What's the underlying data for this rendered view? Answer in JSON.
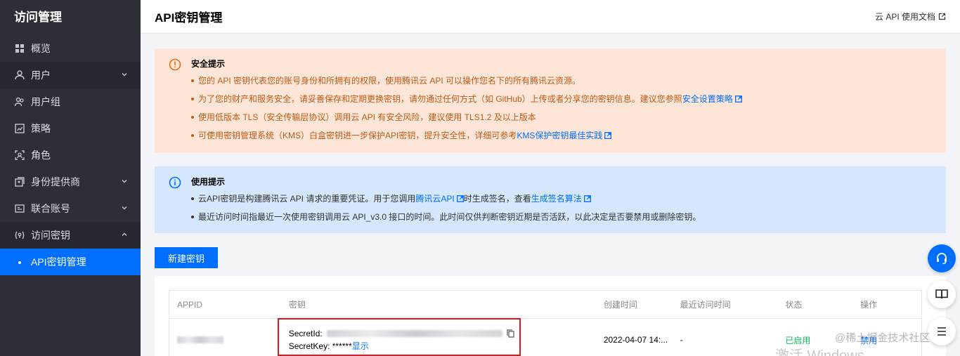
{
  "sidebar": {
    "brand": "访问管理",
    "items": [
      {
        "label": "概览",
        "icon": "grid-icon"
      },
      {
        "label": "用户",
        "icon": "user-icon"
      },
      {
        "label": "用户组",
        "icon": "user-group-icon"
      },
      {
        "label": "策略",
        "icon": "policy-icon"
      },
      {
        "label": "角色",
        "icon": "role-icon"
      },
      {
        "label": "身份提供商",
        "icon": "identity-provider-icon"
      },
      {
        "label": "联合账号",
        "icon": "federated-account-icon"
      },
      {
        "label": "访问密钥",
        "icon": "access-key-icon"
      },
      {
        "label": "API密钥管理"
      }
    ]
  },
  "header": {
    "title": "API密钥管理",
    "doc_link": "云 API 使用文档"
  },
  "security_alert": {
    "title": "安全提示",
    "items": [
      {
        "text": "您的 API 密钥代表您的账号身份和所拥有的权限，使用腾讯云 API 可以操作您名下的所有腾讯云资源。"
      },
      {
        "text": "为了您的财产和服务安全，请妥善保存和定期更换密钥，请勿通过任何方式（如 GitHub）上传或者分享您的密钥信息。建议您参照",
        "link": "安全设置策略"
      },
      {
        "text": "使用低版本 TLS（安全传输层协议）调用云 API 有安全风险，建议使用 TLS1.2 及以上版本"
      },
      {
        "text": "可使用密钥管理系统（KMS）白盒密钥进一步保护API密钥，提升安全性，详细可参考",
        "link": "KMS保护密钥最佳实践"
      }
    ]
  },
  "usage_alert": {
    "title": "使用提示",
    "item1_a": "云API密钥是构建腾讯云 API 请求的重要凭证。用于您调用",
    "item1_link1": "腾讯云API",
    "item1_b": "时生成签名，查看",
    "item1_link2": "生成签名算法",
    "item2": "最近访问时间指最近一次使用密钥调用云 API_v3.0 接口的时间。此时间仅供判断密钥近期是否活跃，以此决定是否要禁用或删除密钥。"
  },
  "new_key_button": "新建密钥",
  "table": {
    "columns": [
      "APPID",
      "密钥",
      "创建时间",
      "最近访问时间",
      "状态",
      "操作"
    ],
    "row": {
      "secret_id_label": "SecretId:",
      "secret_key_label": "SecretKey: ******",
      "show_link": "显示",
      "created": "2022-04-07 14:...",
      "last_access": "-",
      "status": "已启用",
      "action": "禁用"
    }
  },
  "watermark": "@稀土掘金技术社区",
  "activate_text": "激活 Windows",
  "colors": {
    "primary": "#006eff",
    "sidebar": "#2c3036",
    "warn_bg": "#fde6d8",
    "info_bg": "#d5e7fc",
    "success": "#0abf5b",
    "highlight": "#e0161f"
  }
}
